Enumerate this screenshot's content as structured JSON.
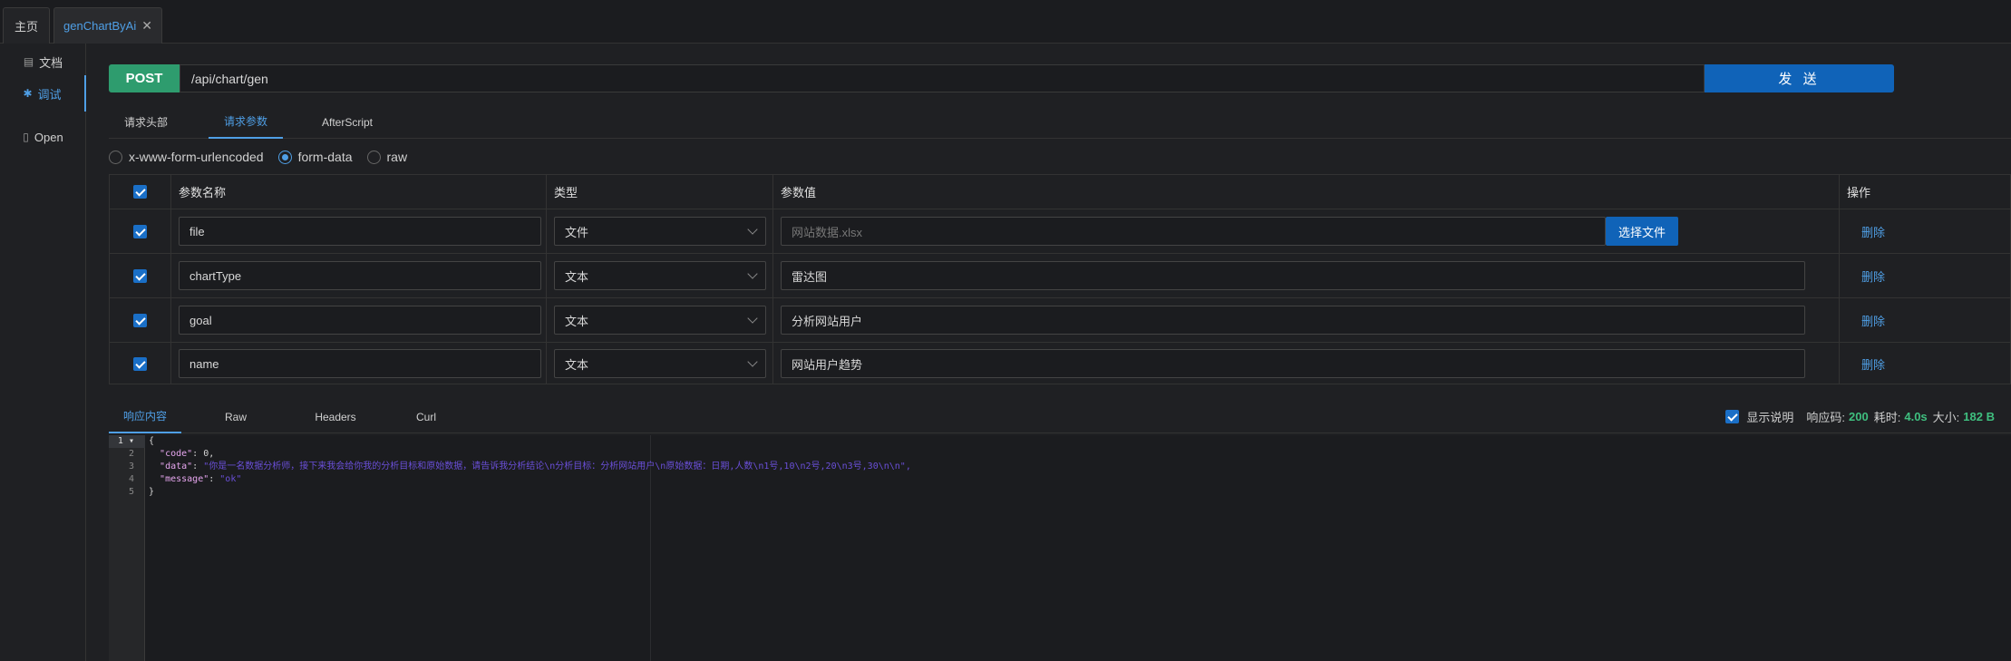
{
  "tabs": [
    {
      "label": "主页"
    },
    {
      "label": "genChartByAi"
    }
  ],
  "sidebar": {
    "items": [
      {
        "label": "文档"
      },
      {
        "label": "调试"
      },
      {
        "label": "Open"
      }
    ]
  },
  "request": {
    "method": "POST",
    "url": "/api/chart/gen",
    "send_label": "发 送"
  },
  "req_tabs": [
    {
      "label": "请求头部"
    },
    {
      "label": "请求参数"
    },
    {
      "label": "AfterScript"
    }
  ],
  "body_types": [
    {
      "label": "x-www-form-urlencoded",
      "selected": false
    },
    {
      "label": "form-data",
      "selected": true
    },
    {
      "label": "raw",
      "selected": false
    }
  ],
  "params_table": {
    "headers": [
      "参数名称",
      "类型",
      "参数值",
      "操作"
    ],
    "rows": [
      {
        "name": "file",
        "type": "文件",
        "value": "网站数据.xlsx",
        "value_is_placeholder": true,
        "file_button": "选择文件",
        "action": "删除"
      },
      {
        "name": "chartType",
        "type": "文本",
        "value": "雷达图",
        "action": "删除"
      },
      {
        "name": "goal",
        "type": "文本",
        "value": "分析网站用户",
        "action": "删除"
      },
      {
        "name": "name",
        "type": "文本",
        "value": "网站用户趋势",
        "action": "删除"
      }
    ]
  },
  "resp_tabs": [
    {
      "label": "响应内容"
    },
    {
      "label": "Raw"
    },
    {
      "label": "Headers"
    },
    {
      "label": "Curl"
    }
  ],
  "resp_meta": {
    "show_desc_label": "显示说明",
    "status_label": "响应码:",
    "status": "200",
    "time_label": "耗时:",
    "time": "4.0s",
    "size_label": "大小:",
    "size": "182 B"
  },
  "response_lines": [
    {
      "n": "1",
      "text": "{"
    },
    {
      "n": "2",
      "key": "\"code\"",
      "rest": ": 0,"
    },
    {
      "n": "3",
      "key": "\"data\"",
      "rest": ": ",
      "value": "\"你是一名数据分析师，接下来我会给你我的分析目标和原始数据，请告诉我分析结论\\n分析目标：分析网站用户\\n原始数据：日期,人数\\n1号,10\\n2号,20\\n3号,30\\n\\n\","
    },
    {
      "n": "4",
      "key": "\"message\"",
      "rest": ": ",
      "value": "\"ok\""
    },
    {
      "n": "5",
      "text": "}"
    }
  ],
  "colors": {
    "accent": "#4f9fe6",
    "post": "#2e9c6e",
    "send": "#1063b8",
    "success": "#3fbf7f"
  }
}
